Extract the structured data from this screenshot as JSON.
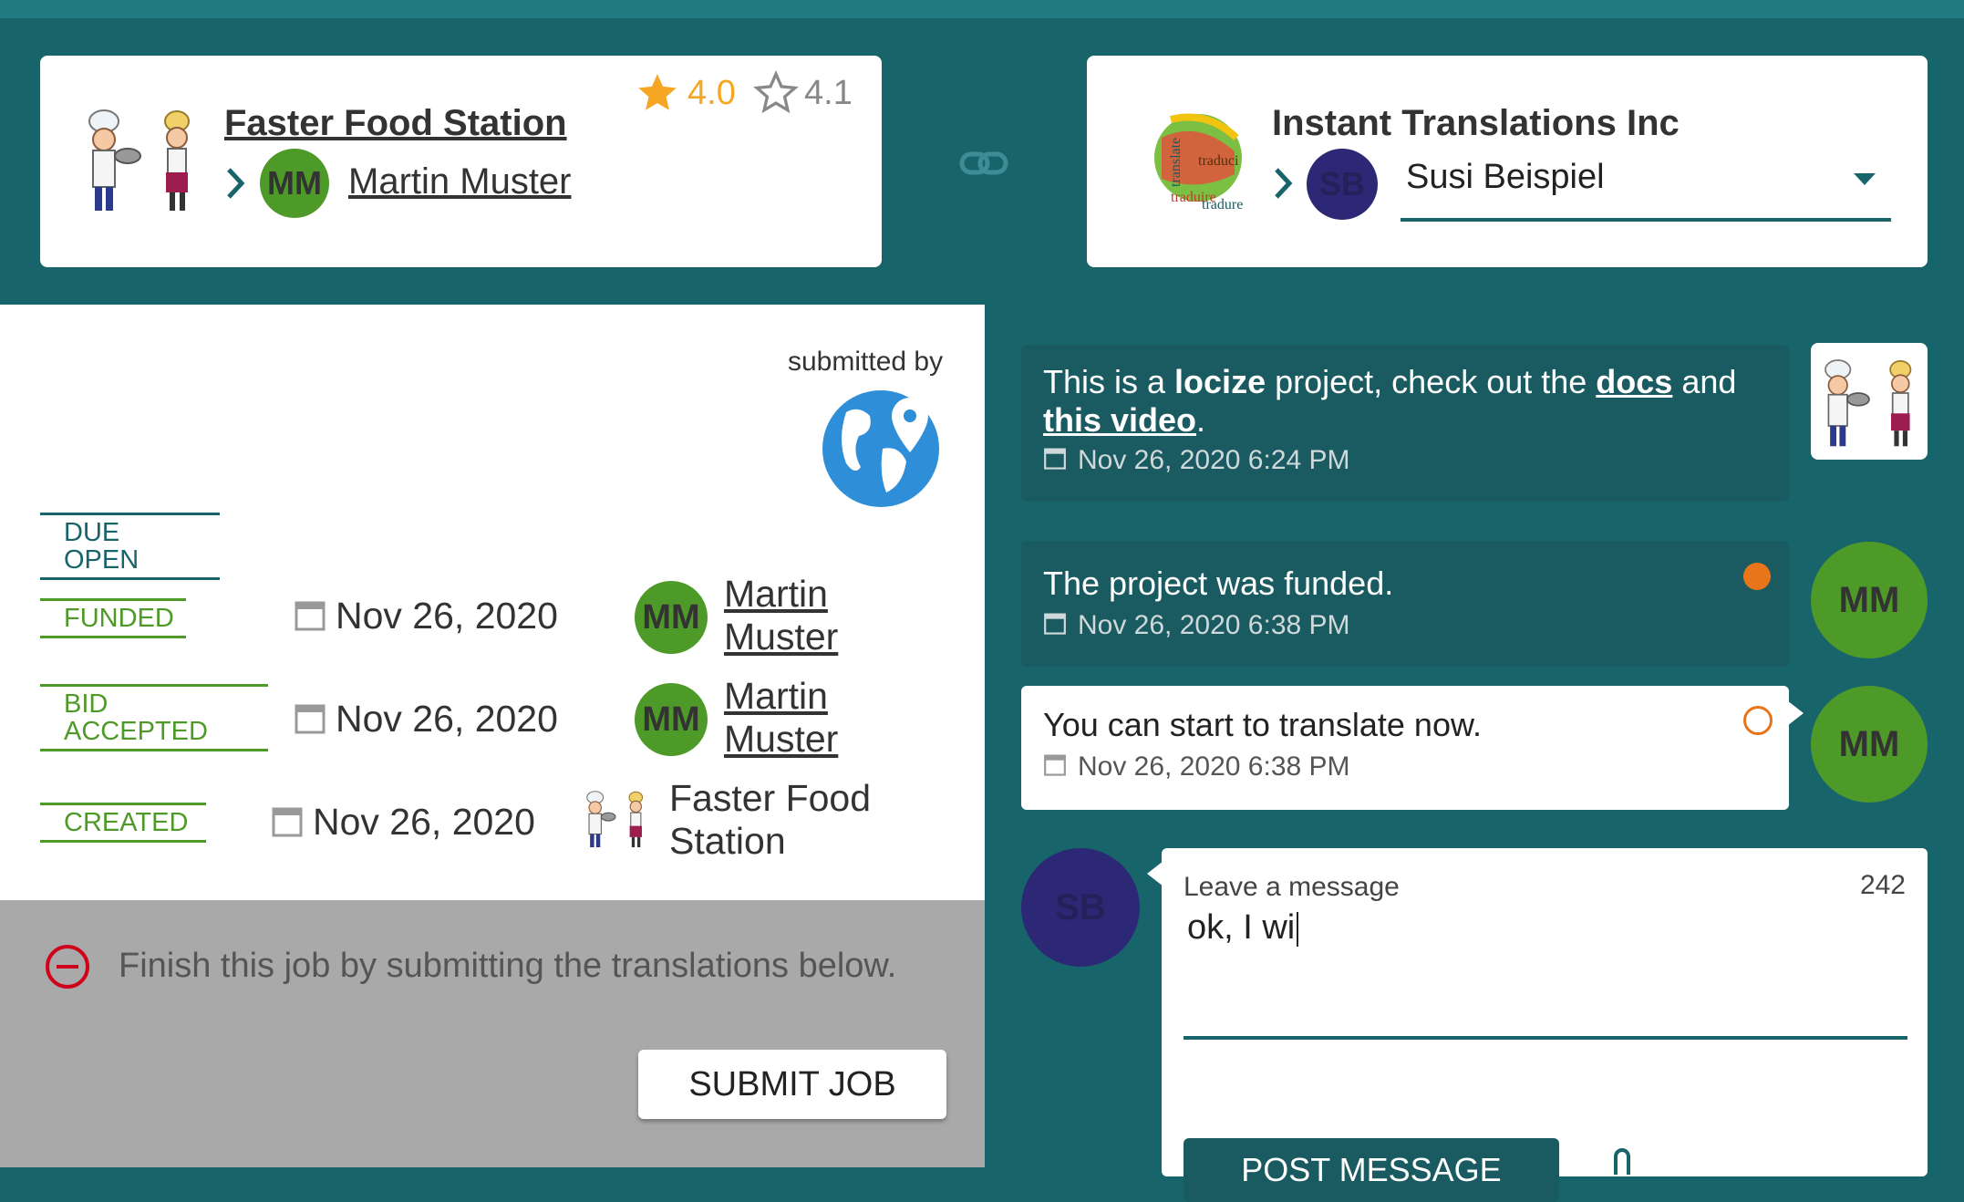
{
  "header": {
    "client": {
      "name": "Faster Food Station",
      "rating_given": "4.0",
      "rating_received": "4.1",
      "contact_initials": "MM",
      "contact_name": "Martin Muster"
    },
    "provider": {
      "name": "Instant Translations Inc",
      "contact_initials": "SB",
      "contact_select_value": "Susi Beispiel"
    }
  },
  "left": {
    "submitted_by_label": "submitted by",
    "statuses": [
      {
        "label": "DUE OPEN"
      },
      {
        "label": "FUNDED",
        "date": "Nov 26, 2020",
        "actor_initials": "MM",
        "actor_line1": "Martin",
        "actor_line2": "Muster"
      },
      {
        "label_line1": "BID",
        "label_line2": "ACCEPTED",
        "date": "Nov 26, 2020",
        "actor_initials": "MM",
        "actor_line1": "Martin",
        "actor_line2": "Muster"
      },
      {
        "label": "CREATED",
        "date": "Nov 26, 2020",
        "actor_line1": "Faster Food",
        "actor_line2": "Station"
      }
    ],
    "notice": "Finish this job by submitting the translations below.",
    "submit_label": "SUBMIT JOB"
  },
  "chat": {
    "messages": [
      {
        "pre": "This is a ",
        "bold": "locize",
        "mid": " project, check out the ",
        "link1": "docs",
        "mid2": " and ",
        "link2": "this video",
        "post": ".",
        "time": "Nov 26, 2020 6:24 PM"
      },
      {
        "text": "The project was funded.",
        "time": "Nov 26, 2020 6:38 PM",
        "avatar": "MM"
      },
      {
        "text": "You can start to translate now.",
        "time": "Nov 26, 2020 6:38 PM",
        "avatar": "MM"
      }
    ],
    "composer": {
      "avatar": "SB",
      "label": "Leave a message",
      "remaining": "242",
      "value": "ok, I wi",
      "post_label": "POST MESSAGE"
    }
  },
  "colors": {
    "background": "#18646b",
    "accent_green": "#4e9a28",
    "avatar_purple": "#2c2876",
    "orange": "#e8751a"
  }
}
